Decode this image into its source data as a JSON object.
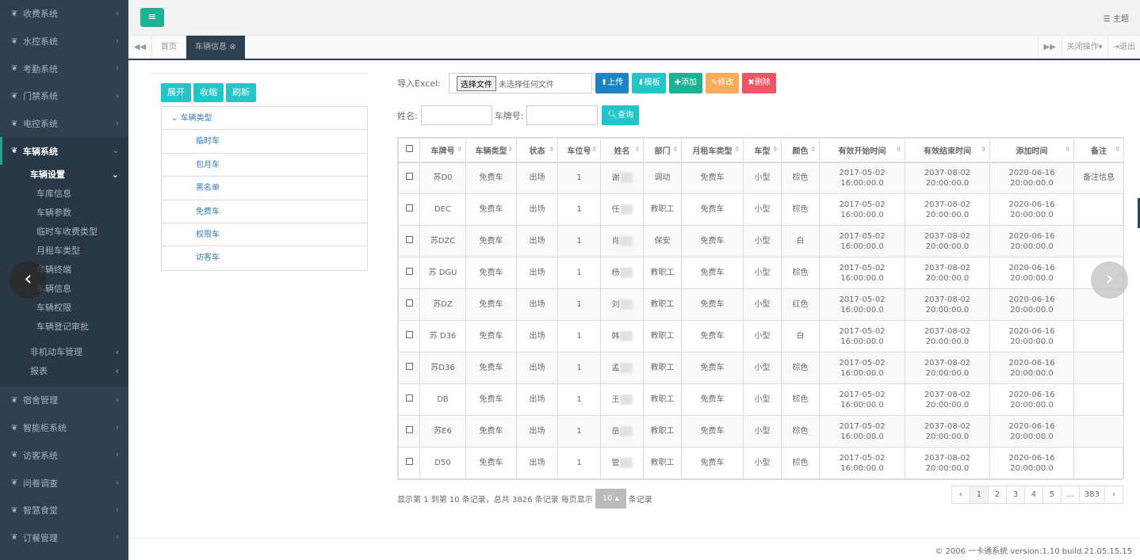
{
  "sidebar": {
    "items_top": [
      {
        "label": "收费系统"
      },
      {
        "label": "水控系统"
      },
      {
        "label": "考勤系统"
      },
      {
        "label": "门禁系统"
      },
      {
        "label": "电控系统"
      }
    ],
    "active": {
      "label": "车辆系统"
    },
    "sub_title": "车辆设置",
    "sub_items": [
      "车库信息",
      "车辆参数",
      "临时车收费类型",
      "月租车类型",
      "车辆终端",
      "车辆信息",
      "车辆权限",
      "车辆登记审批"
    ],
    "sub2": [
      "非机动车管理",
      "报表"
    ],
    "items_bottom": [
      {
        "label": "宿舍管理"
      },
      {
        "label": "智能柜系统"
      },
      {
        "label": "访客系统"
      },
      {
        "label": "问卷调查"
      },
      {
        "label": "智慧食堂"
      },
      {
        "label": "订餐管理"
      }
    ]
  },
  "topbar": {
    "menu_icon": "≡",
    "theme_label": "主题"
  },
  "tabs": {
    "home": "首页",
    "active": "车辆信息",
    "close_ops": "关闭操作",
    "logout": "退出"
  },
  "tree": {
    "buttons": {
      "expand": "展开",
      "collapse": "收缩",
      "refresh": "刷新"
    },
    "root": "车辆类型",
    "nodes": [
      "临时车",
      "包月车",
      "黑名单",
      "免费车",
      "权限车",
      "访客车"
    ]
  },
  "toolbar": {
    "import_label": "导入Excel:",
    "file_button": "选择文件",
    "file_status": "未选择任何文件",
    "upload": "上传",
    "template": "模板",
    "add": "添加",
    "edit": "修改",
    "delete": "删除"
  },
  "search": {
    "name_label": "姓名:",
    "plate_label": "车牌号:",
    "query": "查询"
  },
  "table": {
    "headers": [
      "车牌号",
      "车辆类型",
      "状态",
      "车位号",
      "姓名",
      "部门",
      "月租车类型",
      "车型",
      "颜色",
      "有效开始时间",
      "有效结束时间",
      "添加时间",
      "备注"
    ],
    "rows": [
      {
        "plate": "苏D0",
        "type": "免费车",
        "status": "出场",
        "slot": "1",
        "name": "谢",
        "dept": "调动",
        "monthly": "免费车",
        "model": "小型",
        "color": "棕色",
        "start": "2017-05-02 16:00:00.0",
        "end": "2037-08-02 20:00:00.0",
        "added": "2020-06-16 20:00:00.0",
        "note": "备注信息"
      },
      {
        "plate": "DEC",
        "type": "免费车",
        "status": "出场",
        "slot": "1",
        "name": "任",
        "dept": "教职工",
        "monthly": "免费车",
        "model": "小型",
        "color": "棕色",
        "start": "2017-05-02 16:00:00.0",
        "end": "2037-08-02 20:00:00.0",
        "added": "2020-06-16 20:00:00.0",
        "note": ""
      },
      {
        "plate": "苏DZC",
        "type": "免费车",
        "status": "出场",
        "slot": "1",
        "name": "肖",
        "dept": "保安",
        "monthly": "免费车",
        "model": "小型",
        "color": "白",
        "start": "2017-05-02 16:00:00.0",
        "end": "2037-08-02 20:00:00.0",
        "added": "2020-06-16 20:00:00.0",
        "note": ""
      },
      {
        "plate": "苏 DGU",
        "type": "免费车",
        "status": "出场",
        "slot": "1",
        "name": "杨",
        "dept": "教职工",
        "monthly": "免费车",
        "model": "小型",
        "color": "棕色",
        "start": "2017-05-02 16:00:00.0",
        "end": "2037-08-02 20:00:00.0",
        "added": "2020-06-16 20:00:00.0",
        "note": ""
      },
      {
        "plate": "苏DZ",
        "type": "免费车",
        "status": "出场",
        "slot": "1",
        "name": "刘",
        "dept": "教职工",
        "monthly": "免费车",
        "model": "小型",
        "color": "红色",
        "start": "2017-05-02 16:00:00.0",
        "end": "2037-08-02 20:00:00.0",
        "added": "2020-06-16 20:00:00.0",
        "note": ""
      },
      {
        "plate": "苏 D36",
        "type": "免费车",
        "status": "出场",
        "slot": "1",
        "name": "韩",
        "dept": "教职工",
        "monthly": "免费车",
        "model": "小型",
        "color": "白",
        "start": "2017-05-02 16:00:00.0",
        "end": "2037-08-02 20:00:00.0",
        "added": "2020-06-16 20:00:00.0",
        "note": ""
      },
      {
        "plate": "苏D36",
        "type": "免费车",
        "status": "出场",
        "slot": "1",
        "name": "孟",
        "dept": "教职工",
        "monthly": "免费车",
        "model": "小型",
        "color": "棕色",
        "start": "2017-05-02 16:00:00.0",
        "end": "2037-08-02 20:00:00.0",
        "added": "2020-06-16 20:00:00.0",
        "note": ""
      },
      {
        "plate": "DB",
        "type": "免费车",
        "status": "出场",
        "slot": "1",
        "name": "王",
        "dept": "教职工",
        "monthly": "免费车",
        "model": "小型",
        "color": "棕色",
        "start": "2017-05-02 16:00:00.0",
        "end": "2037-08-02 20:00:00.0",
        "added": "2020-06-16 20:00:00.0",
        "note": ""
      },
      {
        "plate": "苏E6",
        "type": "免费车",
        "status": "出场",
        "slot": "1",
        "name": "岳",
        "dept": "教职工",
        "monthly": "免费车",
        "model": "小型",
        "color": "棕色",
        "start": "2017-05-02 16:00:00.0",
        "end": "2037-08-02 20:00:00.0",
        "added": "2020-06-16 20:00:00.0",
        "note": ""
      },
      {
        "plate": "D50",
        "type": "免费车",
        "status": "出场",
        "slot": "1",
        "name": "管",
        "dept": "教职工",
        "monthly": "免费车",
        "model": "小型",
        "color": "棕色",
        "start": "2017-05-02 16:00:00.0",
        "end": "2037-08-02 20:00:00.0",
        "added": "2020-06-16 20:00:00.0",
        "note": ""
      }
    ]
  },
  "footer_info": {
    "summary": "显示第 1 到第 10 条记录，总共 3826 条记录 每页显示",
    "page_size": "10",
    "records_suffix": "条记录",
    "pages": [
      "‹",
      "1",
      "2",
      "3",
      "4",
      "5",
      "...",
      "383",
      "›"
    ]
  },
  "copyright": "© 2006 一卡通系统 version:1.10 build.21.05.15.15",
  "colors": {
    "teal": "#1ab394",
    "info": "#23c6c8",
    "primary": "#1c84c6",
    "warning": "#f8ac59",
    "danger": "#ed5565",
    "sidebar": "#2f4050"
  }
}
